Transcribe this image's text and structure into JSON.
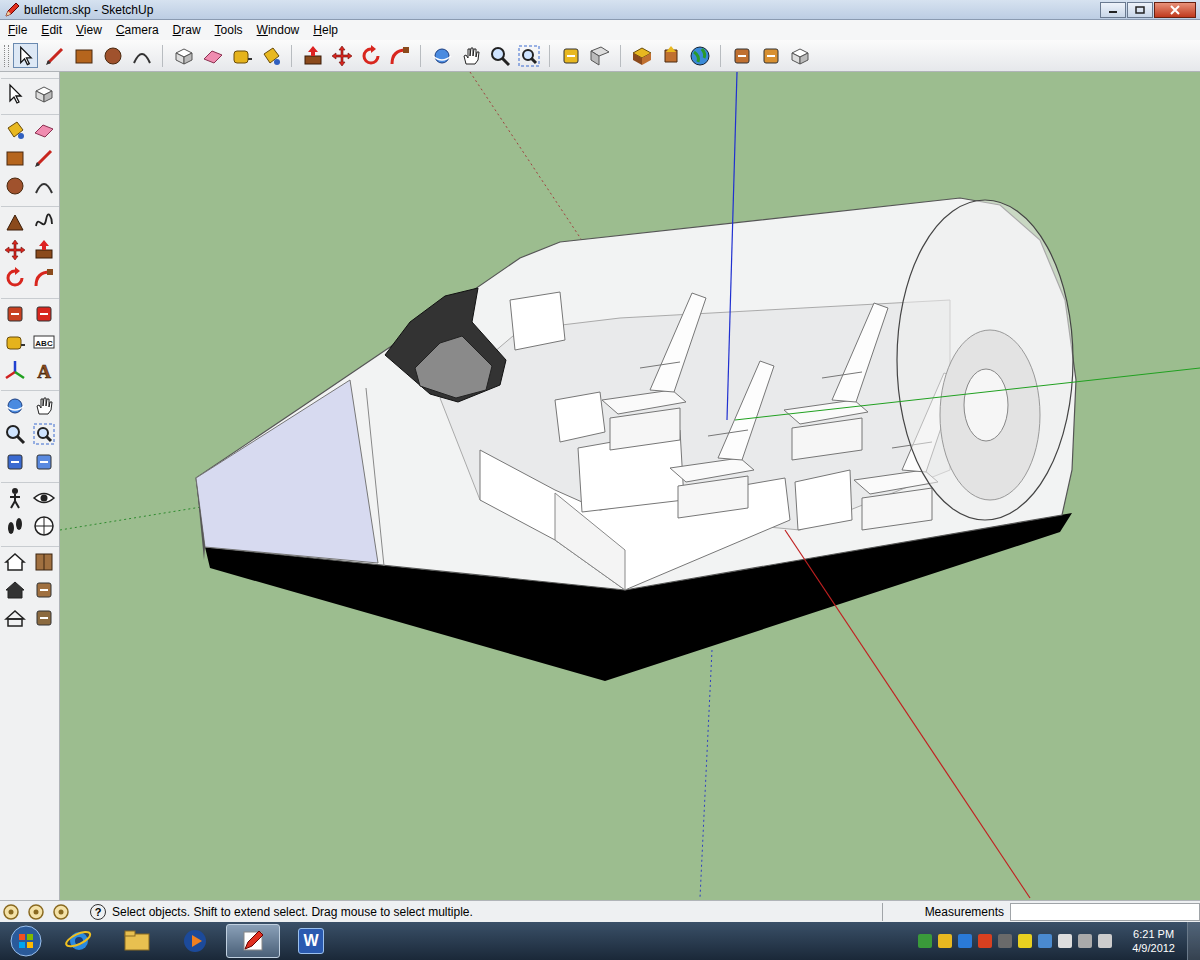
{
  "window": {
    "title": "bulletcm.skp - SketchUp"
  },
  "menu": [
    "File",
    "Edit",
    "View",
    "Camera",
    "Draw",
    "Tools",
    "Window",
    "Help"
  ],
  "left_toolbar": {
    "text_tool_label": "ABC",
    "text3d_tool_label": "A"
  },
  "status_bar": {
    "help_glyph": "?",
    "message": "Select objects. Shift to extend select. Drag mouse to select multiple.",
    "measurements_label": "Measurements",
    "measurements_value": ""
  },
  "taskbar": {
    "apps": [
      {
        "kind": "ie",
        "selected": false,
        "logo": ""
      },
      {
        "kind": "explorer",
        "selected": false,
        "logo": ""
      },
      {
        "kind": "media",
        "selected": false,
        "logo": ""
      },
      {
        "kind": "sketchup",
        "selected": true,
        "logo": ""
      },
      {
        "kind": "word",
        "selected": false,
        "logo": "W"
      }
    ],
    "clock": {
      "time": "6:21 PM",
      "date": "4/9/2012"
    }
  }
}
